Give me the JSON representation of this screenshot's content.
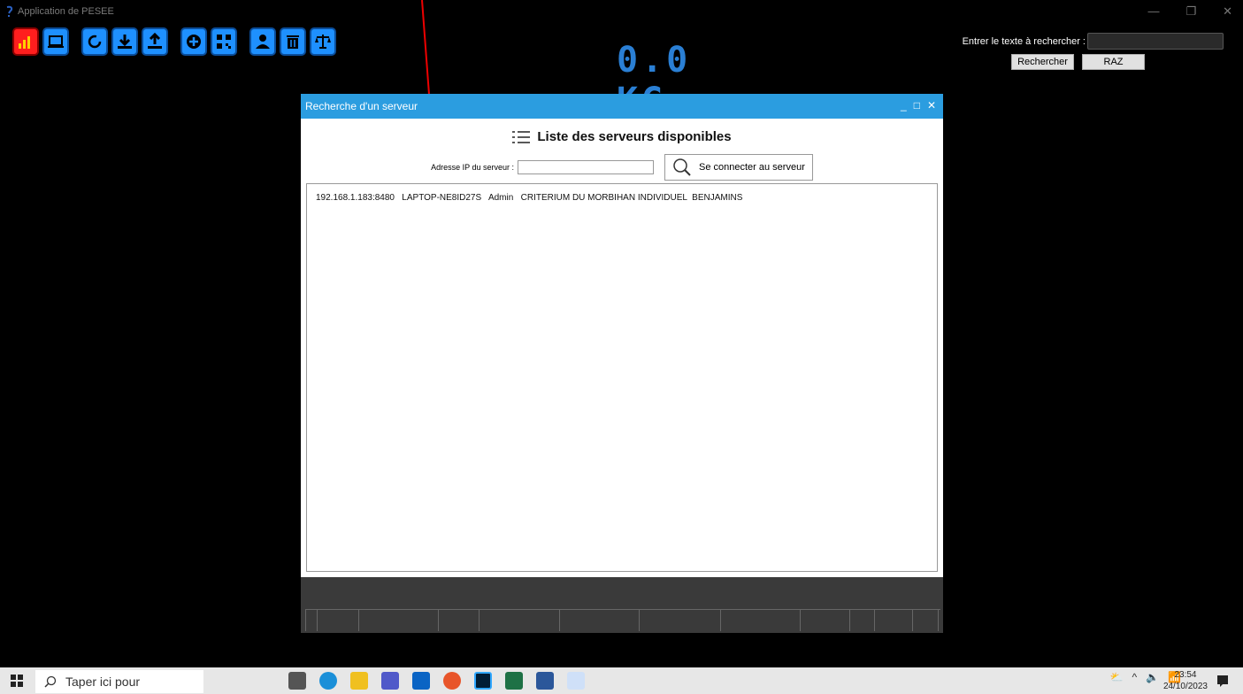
{
  "window": {
    "title": "Application de PESEE",
    "controls": [
      "—",
      "❐",
      "✕"
    ]
  },
  "weight_display": {
    "value": "0.0 KG"
  },
  "search": {
    "label": "Entrer le texte à rechercher :",
    "value": "",
    "search_button": "Rechercher",
    "reset_button": "RAZ"
  },
  "toolbar_icons": [
    "chart-icon",
    "laptop-icon",
    "refresh-icon",
    "download-icon",
    "upload-icon",
    "add-icon",
    "qrcode-icon",
    "user-icon",
    "trash-icon",
    "scale-icon"
  ],
  "dialog": {
    "title": "Recherche d'un serveur",
    "heading": "Liste des serveurs disponibles",
    "ip_label": "Adresse IP du serveur :",
    "ip_value": "",
    "connect_button": "Se connecter au serveur",
    "servers": [
      {
        "entry": "192.168.1.183:8480   LAPTOP-NE8ID27S   Admin   CRITERIUM DU MORBIHAN INDIVIDUEL  BENJAMINS"
      }
    ]
  },
  "taskbar": {
    "search_placeholder": "Taper ici pour",
    "time": "23:54",
    "date": "24/10/2023"
  },
  "colors": {
    "accent_blue": "#1e90ff",
    "active_red": "#ff1e1e",
    "dialog_title": "#2b9de0"
  }
}
